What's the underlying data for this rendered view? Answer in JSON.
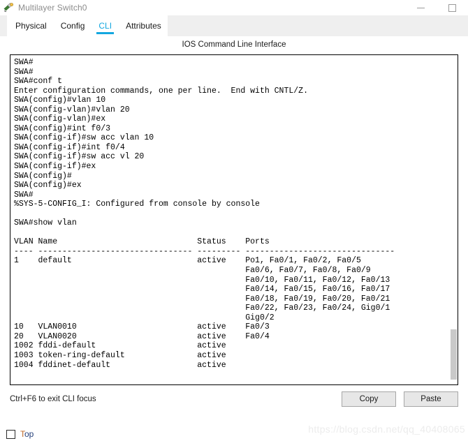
{
  "window": {
    "title": "Multilayer Switch0",
    "icon": "switch-device-icon",
    "minimize_label": "—",
    "maximize_label": "□"
  },
  "tabs": [
    {
      "label": "Physical",
      "active": false
    },
    {
      "label": "Config",
      "active": false
    },
    {
      "label": "CLI",
      "active": true
    },
    {
      "label": "Attributes",
      "active": false
    }
  ],
  "cli": {
    "header": "IOS Command Line Interface",
    "hint": "Ctrl+F6 to exit CLI focus",
    "accent_color": "#13a7e0",
    "terminal_text": "SWA#\nSWA#\nSWA#conf t\nEnter configuration commands, one per line.  End with CNTL/Z.\nSWA(config)#vlan 10\nSWA(config-vlan)#vlan 20\nSWA(config-vlan)#ex\nSWA(config)#int f0/3\nSWA(config-if)#sw acc vlan 10\nSWA(config-if)#int f0/4\nSWA(config-if)#sw acc vl 20\nSWA(config-if)#ex\nSWA(config)#\nSWA(config)#ex\nSWA#\n%SYS-5-CONFIG_I: Configured from console by console\n\nSWA#show vlan\n\nVLAN Name                             Status    Ports\n---- -------------------------------- --------- -------------------------------\n1    default                          active    Po1, Fa0/1, Fa0/2, Fa0/5\n                                                Fa0/6, Fa0/7, Fa0/8, Fa0/9\n                                                Fa0/10, Fa0/11, Fa0/12, Fa0/13\n                                                Fa0/14, Fa0/15, Fa0/16, Fa0/17\n                                                Fa0/18, Fa0/19, Fa0/20, Fa0/21\n                                                Fa0/22, Fa0/23, Fa0/24, Gig0/1\n                                                Gig0/2\n10   VLAN0010                         active    Fa0/3\n20   VLAN0020                         active    Fa0/4\n1002 fddi-default                     active    \n1003 token-ring-default               active    \n1004 fddinet-default                  active    "
  },
  "vlan_table": {
    "columns": [
      "VLAN",
      "Name",
      "Status",
      "Ports"
    ],
    "rows": [
      {
        "vlan": "1",
        "name": "default",
        "status": "active",
        "ports": "Po1, Fa0/1, Fa0/2, Fa0/5, Fa0/6, Fa0/7, Fa0/8, Fa0/9, Fa0/10, Fa0/11, Fa0/12, Fa0/13, Fa0/14, Fa0/15, Fa0/16, Fa0/17, Fa0/18, Fa0/19, Fa0/20, Fa0/21, Fa0/22, Fa0/23, Fa0/24, Gig0/1, Gig0/2"
      },
      {
        "vlan": "10",
        "name": "VLAN0010",
        "status": "active",
        "ports": "Fa0/3"
      },
      {
        "vlan": "20",
        "name": "VLAN0020",
        "status": "active",
        "ports": "Fa0/4"
      },
      {
        "vlan": "1002",
        "name": "fddi-default",
        "status": "active",
        "ports": ""
      },
      {
        "vlan": "1003",
        "name": "token-ring-default",
        "status": "active",
        "ports": ""
      },
      {
        "vlan": "1004",
        "name": "fddinet-default",
        "status": "active",
        "ports": ""
      }
    ]
  },
  "buttons": {
    "copy": "Copy",
    "paste": "Paste"
  },
  "footer": {
    "checkbox_label_part1": "T",
    "checkbox_label_part2": "op",
    "checkbox_checked": false
  },
  "watermark": "https://blog.csdn.net/qq_40408065"
}
